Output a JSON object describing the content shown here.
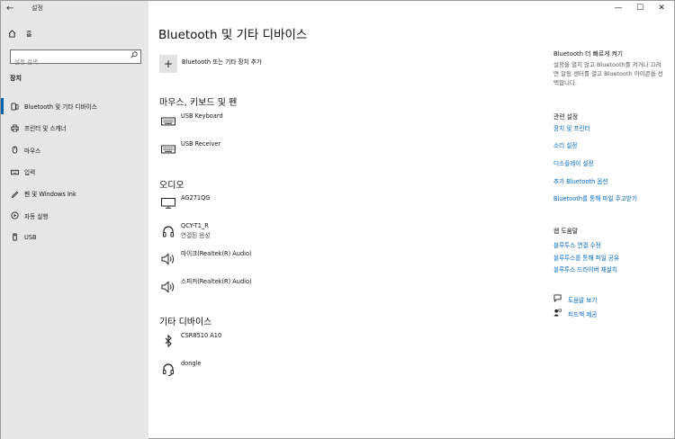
{
  "window": {
    "app_title": "설정",
    "controls": {
      "minimize": "—",
      "maximize": "☐",
      "close": "✕"
    }
  },
  "sidebar": {
    "back_icon": "back-arrow-icon",
    "home_label": "홈",
    "search_placeholder": "설정 검색",
    "section": "장치",
    "items": [
      {
        "label": "Bluetooth 및 기타 디바이스",
        "icon": "bluetooth-device-icon",
        "active": true
      },
      {
        "label": "프린터 및 스캐너",
        "icon": "printer-icon"
      },
      {
        "label": "마우스",
        "icon": "mouse-icon"
      },
      {
        "label": "입력",
        "icon": "keyboard-icon"
      },
      {
        "label": "펜 및 Windows Ink",
        "icon": "pen-icon"
      },
      {
        "label": "자동 실행",
        "icon": "autoplay-icon"
      },
      {
        "label": "USB",
        "icon": "usb-icon"
      }
    ]
  },
  "main": {
    "title": "Bluetooth 및 기타 디바이스",
    "add_device_label": "Bluetooth 또는 기타 장치 추가",
    "groups": [
      {
        "title": "마우스, 키보드 및 펜",
        "devices": [
          {
            "name": "USB Keyboard",
            "icon": "keyboard-icon"
          },
          {
            "name": "USB Receiver",
            "icon": "keyboard-icon"
          }
        ]
      },
      {
        "title": "오디오",
        "devices": [
          {
            "name": "AG271QG",
            "icon": "monitor-icon"
          },
          {
            "name": "QCY-T1_R",
            "status": "연결된 음성",
            "icon": "headphones-icon"
          },
          {
            "name": "마이크(Realtek(R) Audio)",
            "icon": "speaker-icon"
          },
          {
            "name": "스피커(Realtek(R) Audio)",
            "icon": "speaker-icon"
          }
        ]
      },
      {
        "title": "기타 디바이스",
        "devices": [
          {
            "name": "CSR8510 A10",
            "icon": "bluetooth-icon"
          },
          {
            "name": "dongle",
            "icon": "headset-icon"
          }
        ]
      }
    ]
  },
  "right_panel": {
    "quick_title": "Bluetooth 더 빠르게 켜기",
    "quick_desc": "설정을 열지 않고 Bluetooth를 켜거나 끄려면 알림 센터를 열고 Bluetooth 아이콘을 선택합니다.",
    "related_title": "관련 설정",
    "related_links": [
      "장치 및 프린터",
      "소리 설정",
      "디스플레이 설정",
      "추가 Bluetooth 옵션",
      "Bluetooth를 통해 파일 주고받기"
    ],
    "web_help_title": "웹 도움말",
    "web_help_links": [
      "블루투스 연결 수정",
      "블루투스를 통해 파일 공유",
      "블루투스 드라이버 재설치"
    ],
    "help_items": [
      {
        "label": "도움말 보기",
        "icon": "help-chat-icon"
      },
      {
        "label": "피드백 제공",
        "icon": "feedback-icon"
      }
    ]
  },
  "colors": {
    "sidebar_bg": "#e6e6e6",
    "link": "#0067c0",
    "accent": "#0063b1"
  }
}
